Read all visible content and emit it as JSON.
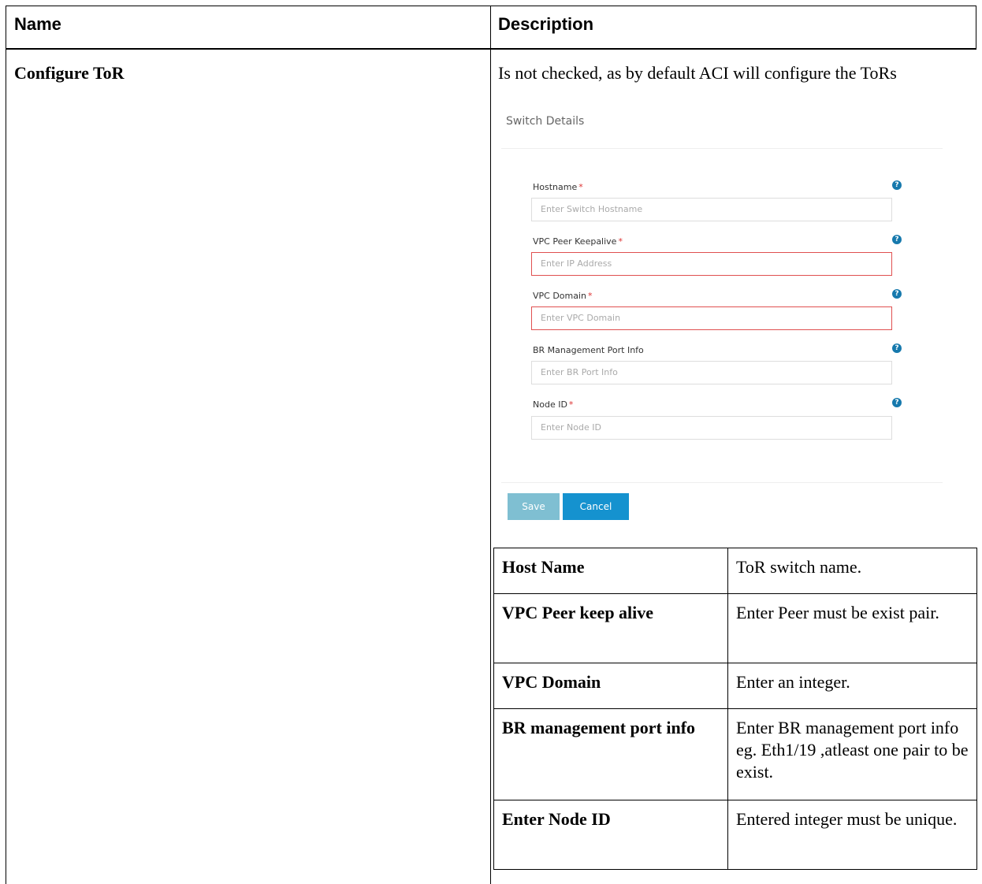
{
  "headers": {
    "name": "Name",
    "description": "Description"
  },
  "row": {
    "name": "Configure ToR",
    "description": "Is not checked, as by default ACI will configure the ToRs"
  },
  "form": {
    "title": "Switch Details",
    "fields": [
      {
        "label": "Hostname",
        "required": "*",
        "placeholder": "Enter Switch Hostname"
      },
      {
        "label": "VPC Peer Keepalive",
        "required": "*",
        "placeholder": "Enter IP Address"
      },
      {
        "label": "VPC Domain",
        "required": "*",
        "placeholder": "Enter VPC Domain"
      },
      {
        "label": "BR Management Port Info",
        "required": "",
        "placeholder": "Enter BR Port Info"
      },
      {
        "label": "Node ID",
        "required": "*",
        "placeholder": "Enter Node ID"
      }
    ],
    "help_icon": "question-icon",
    "help_glyph": "?",
    "save_label": "Save",
    "cancel_label": "Cancel"
  },
  "inner_table": [
    {
      "key": "Host Name",
      "value": "ToR switch name."
    },
    {
      "key": "VPC Peer keep alive",
      "value": "Enter Peer must be exist pair."
    },
    {
      "key": "VPC Domain",
      "value": "Enter an integer."
    },
    {
      "key": "BR management port info",
      "value": "Enter BR management port info eg. Eth1/19 ,atleast one pair to be exist."
    },
    {
      "key": "Enter Node ID",
      "value": "Entered integer must be unique."
    }
  ],
  "colors": {
    "accent": "#1592cf",
    "disabled": "#7fbfd2",
    "error": "#e05050",
    "help": "#1679ad"
  }
}
